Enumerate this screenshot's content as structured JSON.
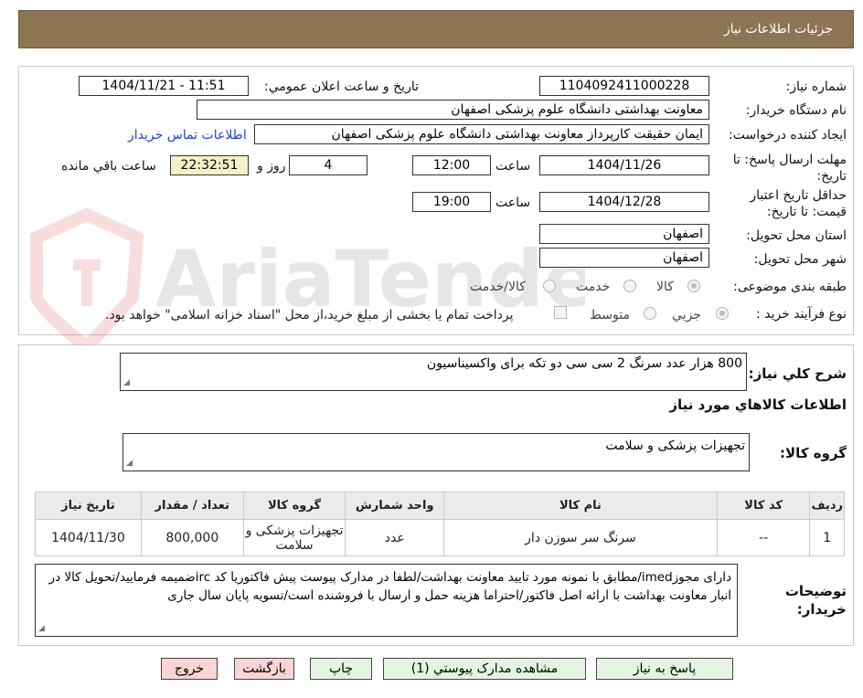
{
  "header": {
    "title": "جزئیات اطلاعات نیاز"
  },
  "form": {
    "need_number_label": "شماره نیاز:",
    "need_number": "1104092411000228",
    "announce_label": "تاریخ و ساعت اعلان عمومي:",
    "announce_value": "1404/11/21 - 11:51",
    "buyer_org_label": "نام دستگاه خریدار:",
    "buyer_org": "معاونت بهداشتی دانشگاه علوم پزشکی اصفهان",
    "requester_label": "ایجاد کننده درخواست:",
    "requester": "ایمان حقیقت کارپرداز معاونت بهداشتی دانشگاه علوم پزشکی اصفهان",
    "contact_link": "اطلاعات تماس خریدار",
    "deadline_label": "مهلت ارسال پاسخ: تا تاریخ:",
    "deadline_date": "1404/11/26",
    "time_label": "ساعت",
    "deadline_time": "12:00",
    "days_value": "4",
    "days_label": "روز و",
    "remaining_time": "22:32:51",
    "remaining_label": "ساعت باقي مانده",
    "validity_label": "حداقل تاریخ اعتبار قیمت: تا تاریخ:",
    "validity_date": "1404/12/28",
    "validity_time": "19:00",
    "province_label": "استان محل تحویل:",
    "province": "اصفهان",
    "city_label": "شهر محل تحویل:",
    "city": "اصفهان",
    "category_label": "طبقه بندی موضوعی:",
    "category_options": [
      "کالا",
      "خدمت",
      "کالا/خدمت"
    ],
    "category_selected": "کالا",
    "process_label": "نوع فرآیند خرید :",
    "process_options": [
      "جزیي",
      "متوسط"
    ],
    "process_selected": "جزیي",
    "payment_note": "پرداخت تمام یا بخشی از مبلغ خرید،از محل \"اسناد خزانه اسلامی\" خواهد بود."
  },
  "details": {
    "summary_label": "شرح کلي نیاز:",
    "summary": "800 هزار عدد سرنگ 2 سی سی دو تکه برای واکسیناسیون",
    "items_heading": "اطلاعات کالاهاي مورد نیاز",
    "group_label": "گروه کالا:",
    "group_value": "تجهیزات پزشکی و سلامت"
  },
  "table": {
    "headers": [
      "ردیف",
      "کد کالا",
      "نام کالا",
      "واحد شمارش",
      "گروه کالا",
      "تعداد / مقدار",
      "تاریخ نیاز"
    ],
    "rows": [
      [
        "1",
        "--",
        "سرنگ سر سوزن دار",
        "عدد",
        "تجهیزات پزشکی و سلامت",
        "800,000",
        "1404/11/30"
      ]
    ]
  },
  "buyer_notes": {
    "label": "توضیحات خریدار:",
    "text": "دارای مجوزimed/مطابق با نمونه مورد تایید معاونت بهداشت/لطفا در مدارک پیوست پیش فاکتوریا کد ircضمیمه فرمایید/تحویل کالا در انبار معاونت بهداشت با ارائه اصل فاکتور/احتراما هزینه حمل و ارسال با فروشنده است/تسویه پایان سال جاری"
  },
  "buttons": {
    "reply": "پاسخ به نیاز",
    "attachments": "مشاهده مدارک پیوستي (1)",
    "print": "چاپ",
    "back": "بازگشت",
    "exit": "خروج"
  },
  "watermark": {
    "text": "AriaTender.neT"
  },
  "colors": {
    "header_bg": "#8d7553",
    "link": "#1e44c9",
    "remaining_bg": "#f6f0c8",
    "btn_green": "#e3f5e1",
    "btn_pink": "#fbd4d4"
  }
}
